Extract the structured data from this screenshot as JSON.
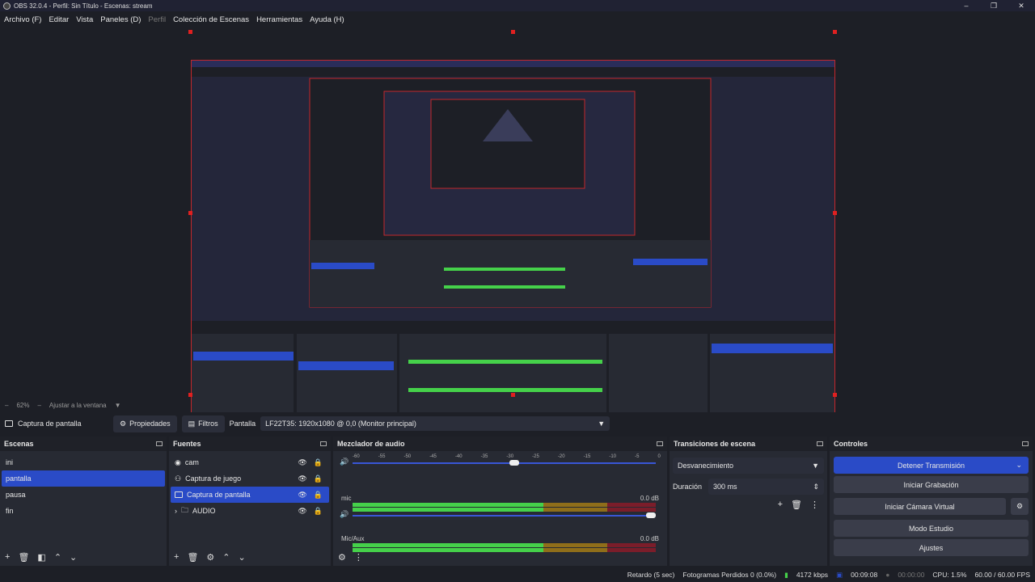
{
  "window": {
    "title": "OBS 32.0.4 - Perfil: Sin Título - Escenas: stream",
    "controls": [
      "–",
      "❐",
      "✕"
    ]
  },
  "menu": {
    "items": [
      "Archivo (F)",
      "Editar",
      "Vista",
      "Paneles (D)",
      "Perfil",
      "Colección de Escenas",
      "Herramientas",
      "Ayuda (H)"
    ]
  },
  "preview": {
    "zoom": "62%",
    "fit_label": "Ajustar a la ventana"
  },
  "source_toolbar": {
    "source_name": "Captura de pantalla",
    "properties": "Propiedades",
    "filters": "Filtros",
    "display_label": "Pantalla",
    "display_value": "LF22T35: 1920x1080 @ 0,0 (Monitor principal)"
  },
  "scenes": {
    "title": "Escenas",
    "items": [
      "ini",
      "pantalla",
      "pausa",
      "fin"
    ],
    "selected": "pantalla"
  },
  "sources": {
    "title": "Fuentes",
    "items": [
      "cam",
      "Captura de juego",
      "Captura de pantalla",
      "AUDIO"
    ],
    "selected": "Captura de pantalla"
  },
  "mixer": {
    "title": "Mezclador de audio",
    "scale": [
      "-60",
      "-55",
      "-50",
      "-45",
      "-40",
      "-35",
      "-30",
      "-25",
      "-20",
      "-15",
      "-10",
      "-5",
      "0"
    ],
    "channels": [
      {
        "name": "",
        "db": "",
        "level": 0.55
      },
      {
        "name": "mic",
        "db": "0.0 dB",
        "level": 1.0
      },
      {
        "name": "Mic/Aux",
        "db": "0.0 dB",
        "level": 0.97
      }
    ]
  },
  "transitions": {
    "title": "Transiciones de escena",
    "type": "Desvanecimiento",
    "duration_label": "Duración",
    "duration_value": "300 ms"
  },
  "controls": {
    "title": "Controles",
    "stop_stream": "Detener Transmisión",
    "start_record": "Iniciar Grabación",
    "virtual_cam": "Iniciar Cámara Virtual",
    "studio_mode": "Modo Estudio",
    "settings": "Ajustes"
  },
  "status": {
    "delay": "Retardo (5 sec)",
    "dropped": "Fotogramas Perdidos 0 (0.0%)",
    "bitrate": "4172 kbps",
    "stream_time": "00:09:08",
    "rec_time": "00:00:00",
    "cpu": "CPU: 1.5%",
    "fps": "60.00 / 60.00 FPS"
  },
  "colors": {
    "accent": "#2a4bc7",
    "selection_border": "#e02020",
    "meter_green": "#45d14a",
    "meter_yellow": "#8f6e1a",
    "meter_red": "#7b1d2a"
  }
}
